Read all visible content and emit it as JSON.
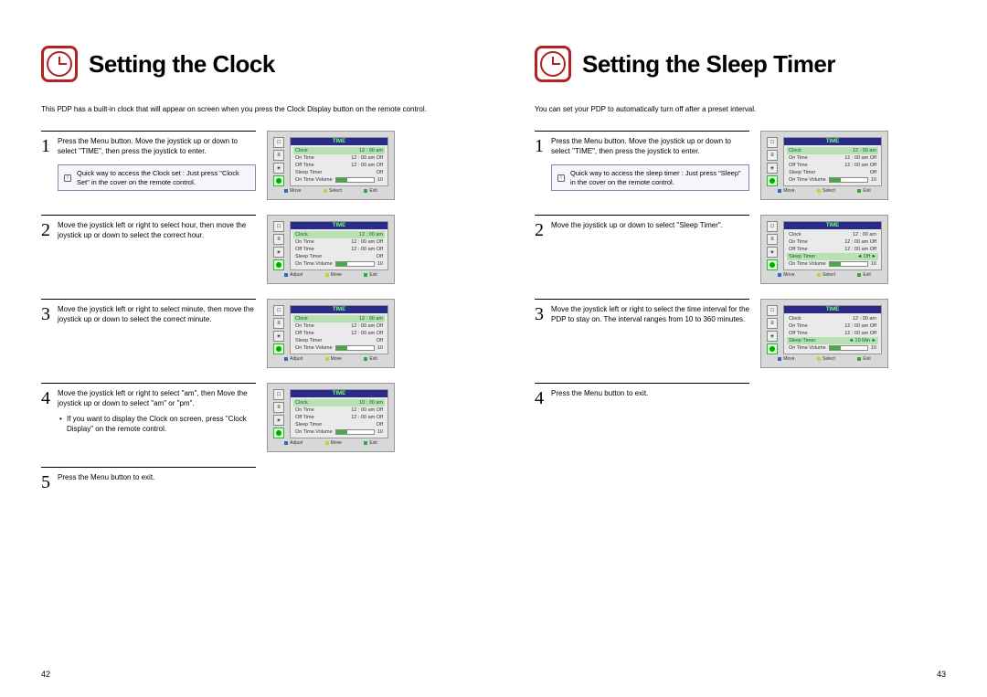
{
  "left": {
    "title": "Setting the Clock",
    "intro": "This PDP has a built-in clock that will appear on screen when you press the Clock Display button on the remote control.",
    "steps": [
      {
        "num": "1",
        "text": "Press the Menu button. Move the joystick up or down to select \"TIME\", then press the joystick to enter.",
        "tip": "Quick way to access the Clock set : Just press \"Clock Set\" in the cover on the remote control.",
        "osd": {
          "title": "TIME",
          "hl": 0,
          "foot": [
            "Move",
            "Select",
            "Exit"
          ],
          "rows": [
            [
              "Clock",
              "12 : 00  am"
            ],
            [
              "On Time",
              "12 : 00  am  Off"
            ],
            [
              "Off Time",
              "12 : 00  am  Off"
            ],
            [
              "Sleep Timer",
              "Off"
            ],
            [
              "On Time Volume",
              "bar",
              "10"
            ]
          ]
        }
      },
      {
        "num": "2",
        "text": "Move the joystick left or right to select  hour, then move the joystick up or down to select the correct hour.",
        "osd": {
          "title": "TIME",
          "hl": 0,
          "foot": [
            "Adjust",
            "Move",
            "Exit"
          ],
          "rows": [
            [
              "Clock",
              "12 : 00  am"
            ],
            [
              "On Time",
              "12 : 00  am  Off"
            ],
            [
              "Off Time",
              "12 : 00  am  Off"
            ],
            [
              "Sleep Timer",
              "Off"
            ],
            [
              "On Time Volume",
              "bar",
              "10"
            ]
          ]
        }
      },
      {
        "num": "3",
        "text": "Move the joystick left or right to select  minute, then move the joystick up or down to select the correct minute.",
        "osd": {
          "title": "TIME",
          "hl": 0,
          "foot": [
            "Adjust",
            "Move",
            "Exit"
          ],
          "rows": [
            [
              "Clock",
              "12 : 00  am"
            ],
            [
              "On Time",
              "12 : 00  am  Off"
            ],
            [
              "Off Time",
              "12 : 00  am  Off"
            ],
            [
              "Sleep Timer",
              "Off"
            ],
            [
              "On Time Volume",
              "bar",
              "10"
            ]
          ]
        }
      },
      {
        "num": "4",
        "text": "Move the joystick left or right to select  \"am\", then Move the joystick up or down to select \"am\" or \"pm\".",
        "bullet": "If you want to display the Clock on screen, press \"Clock Display\" on the remote control.",
        "osd": {
          "title": "TIME",
          "hl": 0,
          "foot": [
            "Adjust",
            "Move",
            "Exit"
          ],
          "rows": [
            [
              "Clock",
              "10 : 30  am"
            ],
            [
              "On Time",
              "12 : 00  am  Off"
            ],
            [
              "Off Time",
              "12 : 00  am  Off"
            ],
            [
              "Sleep Timer",
              "Off"
            ],
            [
              "On Time Volume",
              "bar",
              "10"
            ]
          ]
        }
      },
      {
        "num": "5",
        "text": "Press the Menu button to exit."
      }
    ],
    "pageNum": "42"
  },
  "right": {
    "title": "Setting the Sleep Timer",
    "intro": "You can set your PDP to automatically turn off after a preset interval.",
    "steps": [
      {
        "num": "1",
        "text": "Press the Menu button. Move the joystick up or down to select \"TIME\", then press the joystick to enter.",
        "tip": "Quick way to access the sleep timer : Just press \"Sleep\" in the cover on the remote control.",
        "osd": {
          "title": "TIME",
          "hl": 0,
          "foot": [
            "Move",
            "Select",
            "Exit"
          ],
          "rows": [
            [
              "Clock",
              "12 : 00  am"
            ],
            [
              "On Time",
              "12 : 00  am  Off"
            ],
            [
              "Off Time",
              "12 : 00  am  Off"
            ],
            [
              "Sleep Timer",
              "Off"
            ],
            [
              "On Time Volume",
              "bar",
              "10"
            ]
          ]
        }
      },
      {
        "num": "2",
        "text": "Move the joystick up or down to select \"Sleep Timer\".",
        "osd": {
          "title": "TIME",
          "hl": 3,
          "arrows": true,
          "foot": [
            "Move",
            "Select",
            "Exit"
          ],
          "rows": [
            [
              "Clock",
              "12 : 00  am"
            ],
            [
              "On Time",
              "12 : 00  am  Off"
            ],
            [
              "Off Time",
              "12 : 00  am  Off"
            ],
            [
              "Sleep Timer",
              "◄   Off   ►"
            ],
            [
              "On Time Volume",
              "bar",
              "10"
            ]
          ]
        }
      },
      {
        "num": "3",
        "text": "Move the joystick left or right to select the time interval for the PDP to stay on. The interval ranges from 10 to 360 minutes.",
        "osd": {
          "title": "TIME",
          "hl": 3,
          "arrows": true,
          "foot": [
            "Move",
            "Select",
            "Exit"
          ],
          "rows": [
            [
              "Clock",
              "12 : 00  am"
            ],
            [
              "On Time",
              "12 : 00  am  Off"
            ],
            [
              "Off Time",
              "12 : 00  am  Off"
            ],
            [
              "Sleep Timer",
              "◄ 10 Min ►"
            ],
            [
              "On Time Volume",
              "bar",
              "10"
            ]
          ]
        }
      },
      {
        "num": "4",
        "text": "Press the Menu button to exit."
      }
    ],
    "pageNum": "43"
  },
  "osdIcons": [
    "□",
    "≡",
    "☀",
    "●"
  ]
}
